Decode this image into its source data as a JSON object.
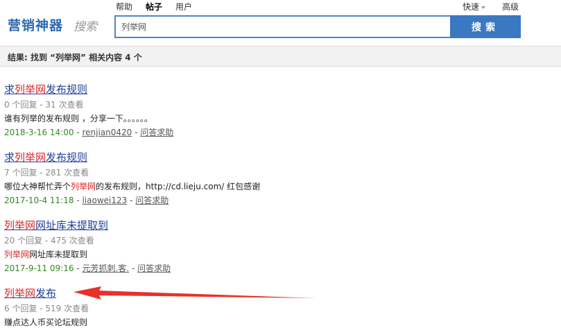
{
  "logo": {
    "main": "营销神器",
    "sub": "搜索"
  },
  "tabs": [
    {
      "label": "帮助"
    },
    {
      "label": "帖子"
    },
    {
      "label": "用户"
    }
  ],
  "right_links": {
    "quick": "快速",
    "advanced": "高级"
  },
  "search": {
    "value": "列举网",
    "button": "搜索"
  },
  "results_summary": "结果: 找到 “列举网” 相关内容 4 个",
  "results": [
    {
      "title_pre": "求",
      "title_hl": "列举网",
      "title_post": "发布规则",
      "meta": "0 个回复 - 31 次查看",
      "snip_pre": "谁有列举的发布规则 ，分享一下。。。。。。",
      "snip_hl": "",
      "snip_post": "",
      "date": "2018-3-16 14:00",
      "author": "renjian0420",
      "forum": "问答求助"
    },
    {
      "title_pre": "求",
      "title_hl": "列举网",
      "title_post": "发布规则",
      "meta": "7 个回复 - 281 次查看",
      "snip_pre": "哪位大神帮忙弄个",
      "snip_hl": "列举网",
      "snip_post": "的发布规则，http://cd.lieju.com/ 红包感谢",
      "date": "2017-10-4 11:18",
      "author": "liaowei123",
      "forum": "问答求助"
    },
    {
      "title_pre": "",
      "title_hl": "列举网",
      "title_post": "网址库未提取到",
      "meta": "20 个回复 - 475 次查看",
      "snip_pre": "",
      "snip_hl": "列举网",
      "snip_post": "网址库未提取到",
      "date": "2017-9-11 09:16",
      "author": "元芳抓刺.客.",
      "forum": "问答求助"
    },
    {
      "title_pre": "",
      "title_hl": "列举网",
      "title_post": "发布",
      "meta": "6 个回复 - 519 次查看",
      "snip_pre": "赚点达人币买论坛规则",
      "snip_hl": "",
      "snip_post": ""
    }
  ],
  "colors": {
    "accent": "#3b78c2",
    "highlight": "#dd2222",
    "annotation_arrow": "#e8302a"
  }
}
